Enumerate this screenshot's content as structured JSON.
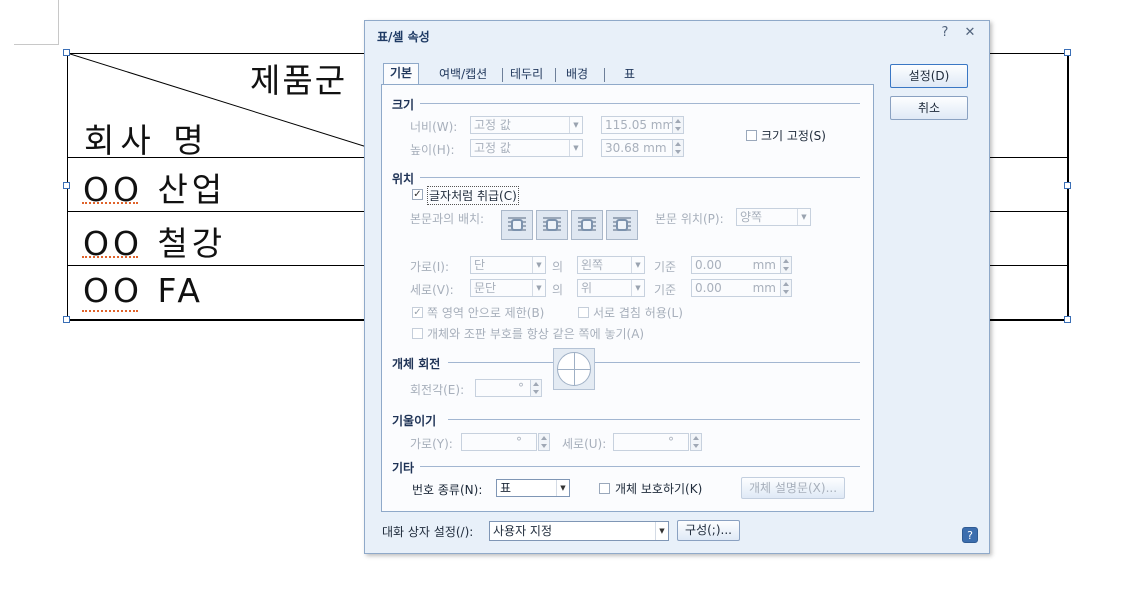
{
  "document": {
    "table": {
      "header_top": "제품군",
      "header_bottom": "회사 명",
      "rows": [
        "OO 산업",
        "OO 철강",
        "OO FA"
      ]
    }
  },
  "dialog": {
    "title": "표/셀 속성",
    "title_buttons": {
      "help": "?",
      "close": "✕"
    },
    "tabs": [
      "기본",
      "여백/캡션",
      "테두리",
      "배경",
      "표"
    ],
    "buttons": {
      "ok": "설정(D)",
      "cancel": "취소"
    },
    "size": {
      "section": "크기",
      "width_label": "너비(W):",
      "width_mode": "고정 값",
      "width_value": "115.05 mm",
      "height_label": "높이(H):",
      "height_mode": "고정 값",
      "height_value": "30.68   mm",
      "fix_size_label": "크기 고정(S)",
      "fix_size_checked": false
    },
    "position": {
      "section": "위치",
      "treat_as_char_label": "글자처럼 취급(C)",
      "treat_as_char_checked": true,
      "text_arrange_label": "본문과의 배치:",
      "text_position_label": "본문 위치(P):",
      "text_position_value": "양쪽",
      "horiz_label": "가로(I):",
      "horiz_mode": "단",
      "horiz_of": "의",
      "horiz_align": "왼쪽",
      "horiz_base": "기준",
      "horiz_value": "0.00",
      "horiz_unit": "mm",
      "vert_label": "세로(V):",
      "vert_mode": "문단",
      "vert_of": "의",
      "vert_align": "위",
      "vert_base": "기준",
      "vert_value": "0.00",
      "vert_unit": "mm",
      "limit_label": "쪽 영역 안으로 제한(B)",
      "limit_checked": true,
      "overlap_label": "서로 겹침 허용(L)",
      "overlap_checked": false,
      "same_page_label": "개체와 조판 부호를 항상 같은 쪽에 놓기(A)",
      "same_page_checked": false
    },
    "rotation": {
      "section": "개체 회전",
      "angle_label": "회전각(E):",
      "angle_unit": "°"
    },
    "skew": {
      "section": "기울이기",
      "horiz_label": "가로(Y):",
      "horiz_unit": "°",
      "vert_label": "세로(U):",
      "vert_unit": "°"
    },
    "misc": {
      "section": "기타",
      "number_type_label": "번호 종류(N):",
      "number_type_value": "표",
      "protect_label": "개체 보호하기(K)",
      "protect_checked": false,
      "description_button": "개체 설명문(X)..."
    },
    "footer": {
      "settings_label": "대화 상자 설정(/):",
      "settings_value": "사용자 지정",
      "compose_button": "구성(;)..."
    }
  }
}
